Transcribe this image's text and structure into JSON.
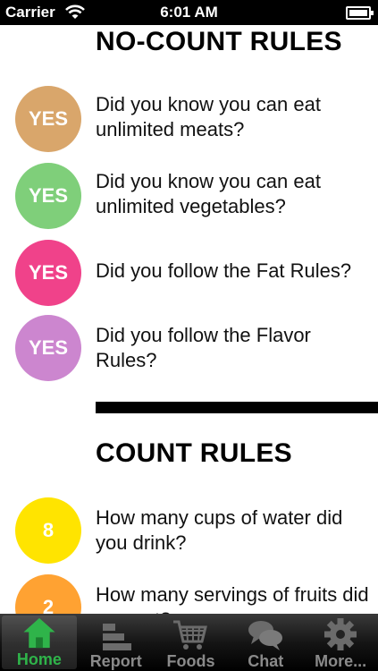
{
  "status_bar": {
    "carrier": "Carrier",
    "time": "6:01 AM"
  },
  "no_count": {
    "title": "NO-COUNT RULES",
    "items": [
      {
        "badge": "YES",
        "color": "#d9a66b",
        "text": "Did you know you can eat unlimited meats?"
      },
      {
        "badge": "YES",
        "color": "#7fcf7a",
        "text": "Did you know you can eat unlimited vegetables?"
      },
      {
        "badge": "YES",
        "color": "#f0428a",
        "text": "Did you follow the Fat Rules?"
      },
      {
        "badge": "YES",
        "color": "#cc86cf",
        "text": "Did you follow the Flavor Rules?"
      }
    ]
  },
  "count": {
    "title": "COUNT RULES",
    "items": [
      {
        "badge": "8",
        "color": "#ffe400",
        "text": "How many cups of water did you drink?"
      },
      {
        "badge": "2",
        "color": "#ffa232",
        "text": "How many servings of fruits did you eat?"
      }
    ]
  },
  "tabs": [
    {
      "label": "Home",
      "icon": "home-icon",
      "active": true
    },
    {
      "label": "Report",
      "icon": "report-icon",
      "active": false
    },
    {
      "label": "Foods",
      "icon": "cart-icon",
      "active": false
    },
    {
      "label": "Chat",
      "icon": "chat-icon",
      "active": false
    },
    {
      "label": "More...",
      "icon": "gear-icon",
      "active": false
    }
  ]
}
